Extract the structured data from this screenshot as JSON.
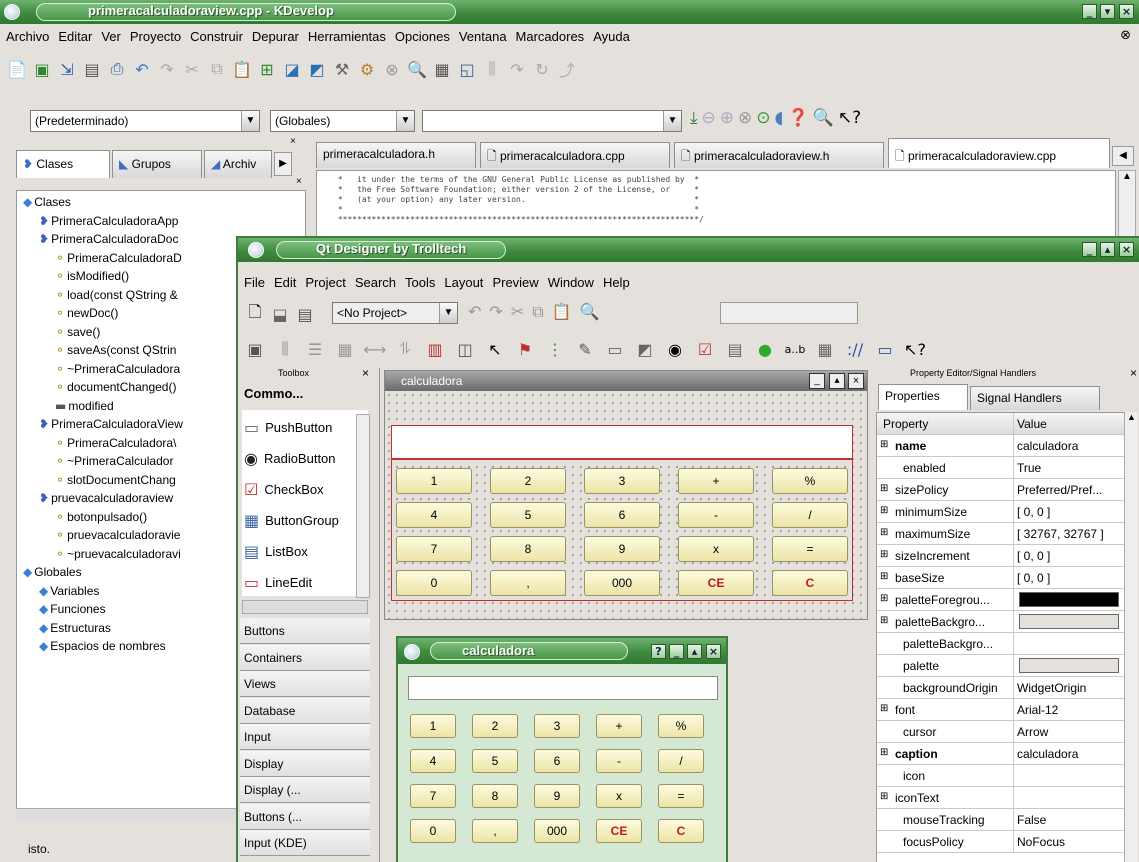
{
  "kdevelop": {
    "title": "primeracalculadoraview.cpp - KDevelop",
    "menu": [
      "Archivo",
      "Editar",
      "Ver",
      "Proyecto",
      "Construir",
      "Depurar",
      "Herramientas",
      "Opciones",
      "Ventana",
      "Marcadores",
      "Ayuda"
    ],
    "combo1": "(Predeterminado)",
    "combo2": "(Globales)",
    "combo3": "",
    "panel_tabs": [
      "Clases",
      "Grupos",
      "Archiv"
    ],
    "tree": [
      "Clases",
      "PrimeraCalculadoraApp",
      "PrimeraCalculadoraDoc",
      "PrimeraCalculadoraD",
      "isModified()",
      "load(const QString &",
      "newDoc()",
      "save()",
      "saveAs(const QStrin",
      "~PrimeraCalculadora",
      "documentChanged()",
      "modified",
      "PrimeraCalculadoraView",
      "PrimeraCalculadora\\",
      "~PrimeraCalculador",
      "slotDocumentChang",
      "pruevacalculadoraview",
      "botonpulsado()",
      "pruevacalculadoravie",
      "~pruevacalculadoravi",
      "Globales",
      "Variables",
      "Funciones",
      "Estructuras",
      "Espacios de nombres"
    ],
    "status": "isto.",
    "editor_tabs": [
      "primeracalculadora.h",
      "primeracalculadora.cpp",
      "primeracalculadoraview.h",
      "primeracalculadoraview.cpp"
    ],
    "code_lines": [
      " *   it under the terms of the GNU General Public License as published by  *",
      " *   the Free Software Foundation; either version 2 of the License, or     *",
      " *   (at your option) any later version.                                   *",
      " *                                                                         *",
      " ***************************************************************************/"
    ]
  },
  "designer": {
    "title": "Qt Designer by Trolltech",
    "menu": [
      "File",
      "Edit",
      "Project",
      "Search",
      "Tools",
      "Layout",
      "Preview",
      "Window",
      "Help"
    ],
    "project_combo": "<No Project>",
    "toolbox_title": "Toolbox",
    "toolbox_section": "Commo...",
    "widgets": [
      "PushButton",
      "RadioButton",
      "CheckBox",
      "ButtonGroup",
      "ListBox",
      "LineEdit"
    ],
    "categories": [
      "Buttons",
      "Containers",
      "Views",
      "Database",
      "Input",
      "Display",
      "Display (...",
      "Buttons (...",
      "Input (KDE)"
    ],
    "form_title": "calculadora",
    "keys": [
      [
        "1",
        "2",
        "3",
        "+",
        "%"
      ],
      [
        "4",
        "5",
        "6",
        "-",
        "/"
      ],
      [
        "7",
        "8",
        "9",
        "x",
        "="
      ],
      [
        "0",
        ",",
        "000",
        "CE",
        "C"
      ]
    ],
    "preview_title": "calculadora",
    "pe_title": "Property Editor/Signal Handlers",
    "pe_tabs": [
      "Properties",
      "Signal Handlers"
    ],
    "pe_headers": [
      "Property",
      "Value"
    ],
    "properties": [
      {
        "k": "name",
        "v": "calculadora",
        "bold": true,
        "exp": true
      },
      {
        "k": "enabled",
        "v": "True"
      },
      {
        "k": "sizePolicy",
        "v": "Preferred/Pref...",
        "exp": true
      },
      {
        "k": "minimumSize",
        "v": "[ 0, 0 ]",
        "exp": true
      },
      {
        "k": "maximumSize",
        "v": "[ 32767, 32767 ]",
        "exp": true
      },
      {
        "k": "sizeIncrement",
        "v": "[ 0, 0 ]",
        "exp": true
      },
      {
        "k": "baseSize",
        "v": "[ 0, 0 ]",
        "exp": true
      },
      {
        "k": "paletteForegrou...",
        "v": "",
        "exp": true,
        "swatch": "#000000"
      },
      {
        "k": "paletteBackgro...",
        "v": "",
        "exp": true,
        "swatch": "#e4e1dc"
      },
      {
        "k": "paletteBackgro...",
        "v": ""
      },
      {
        "k": "palette",
        "v": "",
        "swatch": "#e4e1dc"
      },
      {
        "k": "backgroundOrigin",
        "v": "WidgetOrigin"
      },
      {
        "k": "font",
        "v": "Arial-12",
        "exp": true
      },
      {
        "k": "cursor",
        "v": "Arrow"
      },
      {
        "k": "caption",
        "v": "calculadora",
        "bold": true,
        "exp": true
      },
      {
        "k": "icon",
        "v": ""
      },
      {
        "k": "iconText",
        "v": "",
        "exp": true
      },
      {
        "k": "mouseTracking",
        "v": "False"
      },
      {
        "k": "focusPolicy",
        "v": "NoFocus"
      }
    ]
  },
  "colors": {
    "title_green": "#3f8a3f",
    "key_yellow": "#f4eebf",
    "key_red_text": "#c41a1a"
  }
}
